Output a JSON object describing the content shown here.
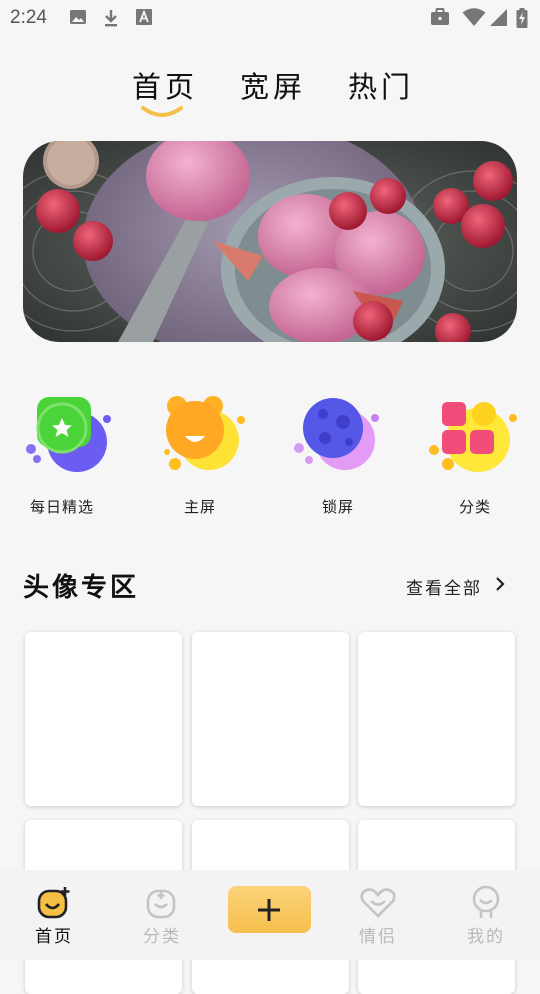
{
  "status_bar": {
    "time": "2:24",
    "icons": [
      "image-icon",
      "download-icon",
      "font-icon",
      "briefcase-icon",
      "wifi-icon",
      "signal-icon",
      "battery-charging-icon"
    ]
  },
  "top_tabs": [
    {
      "label": "首页",
      "active": true
    },
    {
      "label": "宽屏",
      "active": false
    },
    {
      "label": "热门",
      "active": false
    }
  ],
  "banner": {
    "image": "ice-cream-raspberries-photo"
  },
  "categories": [
    {
      "label": "每日精选",
      "icon": "star-badge-icon"
    },
    {
      "label": "主屏",
      "icon": "smile-bear-icon"
    },
    {
      "label": "锁屏",
      "icon": "moon-planet-icon"
    },
    {
      "label": "分类",
      "icon": "grid-squares-icon"
    }
  ],
  "avatar_section": {
    "title": "头像专区",
    "view_all": "查看全部"
  },
  "bottom_nav": [
    {
      "label": "首页",
      "icon": "home-smile-icon",
      "active": true
    },
    {
      "label": "分类",
      "icon": "category-icon",
      "active": false
    },
    {
      "label": "",
      "icon": "plus-icon",
      "active": false
    },
    {
      "label": "情侣",
      "icon": "heart-couple-icon",
      "active": false
    },
    {
      "label": "我的",
      "icon": "profile-icon",
      "active": false
    }
  ],
  "colors": {
    "accent": "#f6bf4c",
    "active_text": "#111111",
    "inactive_text": "#b9b9b9"
  }
}
